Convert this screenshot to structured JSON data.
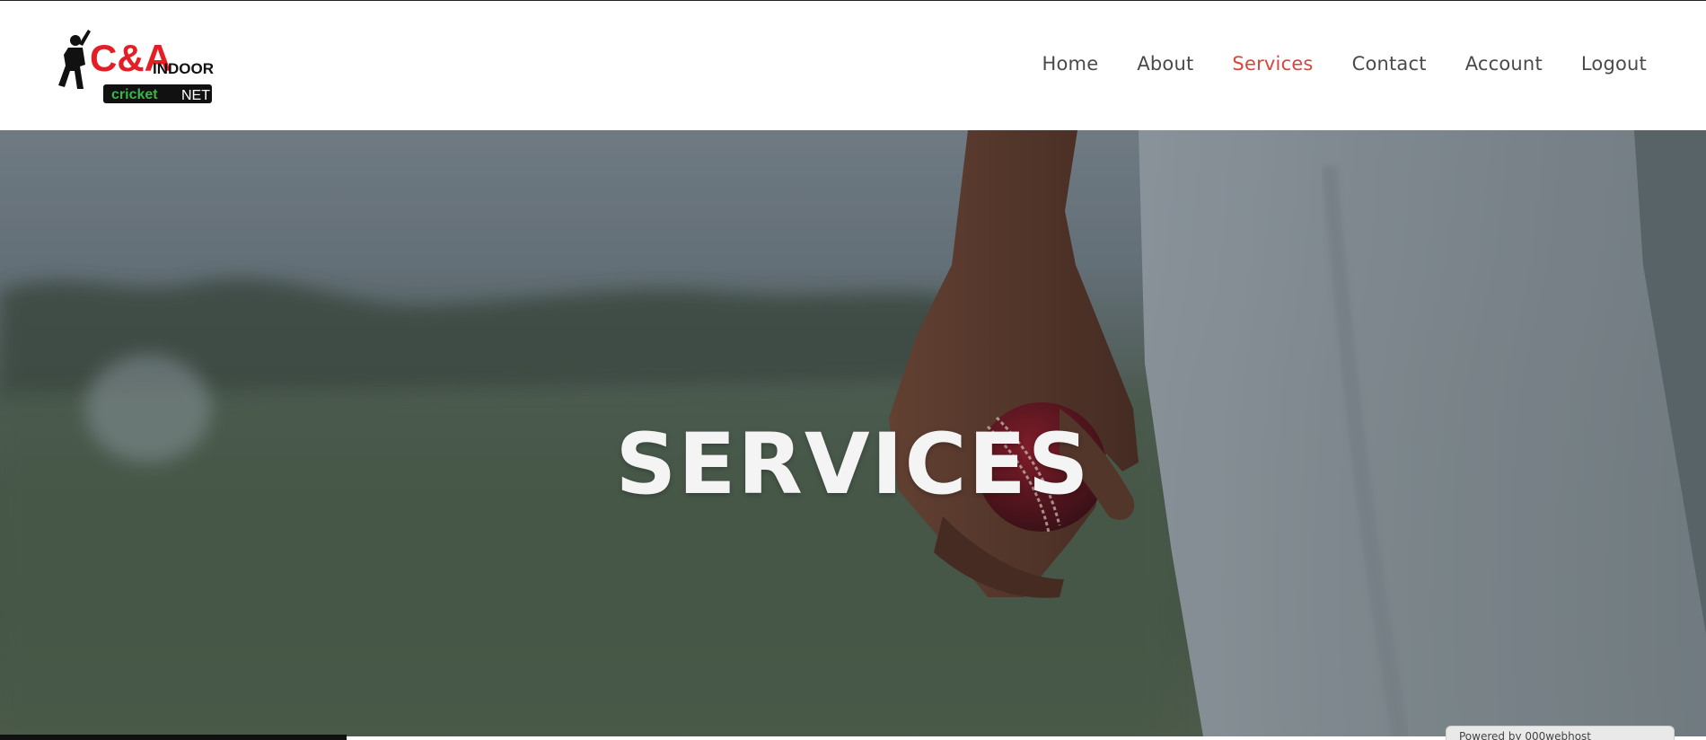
{
  "brand": {
    "logo_main": "C&A",
    "logo_indoor": "INDOOR",
    "logo_cricket": "cricket",
    "logo_net": "NET"
  },
  "nav": {
    "items": [
      {
        "label": "Home",
        "active": false
      },
      {
        "label": "About",
        "active": false
      },
      {
        "label": "Services",
        "active": true
      },
      {
        "label": "Contact",
        "active": false
      },
      {
        "label": "Account",
        "active": false
      },
      {
        "label": "Logout",
        "active": false
      }
    ]
  },
  "hero": {
    "title": "SERVICES"
  },
  "badge": {
    "text": "Powered by 000webhost"
  },
  "colors": {
    "accent": "#d9443c",
    "nav_text": "#4a4a4a",
    "logo_red": "#e31e24",
    "logo_green": "#3bb54a"
  }
}
